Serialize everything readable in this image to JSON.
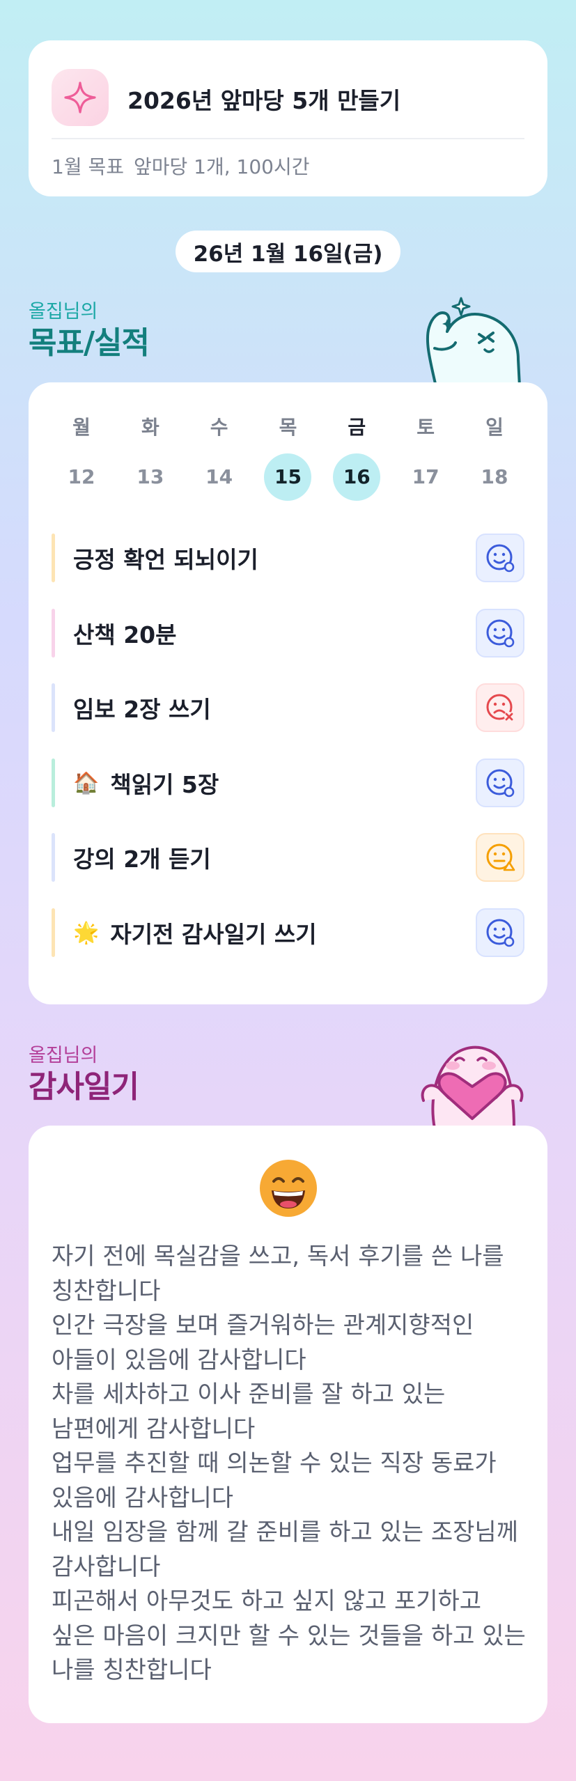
{
  "goal": {
    "title": "2026년 앞마당 5개 만들기",
    "month_label": "1월 목표",
    "month_value": "앞마당 1개, 100시간",
    "icon": "sparkle-icon"
  },
  "date_label": "26년 1월 16일(금)",
  "goals_section": {
    "owner": "올집님의",
    "title": "목표/실적"
  },
  "week": {
    "days": [
      {
        "name": "월",
        "num": "12"
      },
      {
        "name": "화",
        "num": "13"
      },
      {
        "name": "수",
        "num": "14"
      },
      {
        "name": "목",
        "num": "15"
      },
      {
        "name": "금",
        "num": "16"
      },
      {
        "name": "토",
        "num": "17"
      },
      {
        "name": "일",
        "num": "18"
      }
    ],
    "today_index": 4,
    "highlighted_index": [
      3,
      4
    ]
  },
  "habits": [
    {
      "label": "긍정 확언 되뇌이기",
      "emoji": "",
      "status": "done",
      "bar_color": "#fde4b4"
    },
    {
      "label": "산책 20분",
      "emoji": "",
      "status": "done",
      "bar_color": "#f8d3ea"
    },
    {
      "label": "임보 2장 쓰기",
      "emoji": "",
      "status": "failed",
      "bar_color": "#dbe3fb"
    },
    {
      "label": "책읽기 5장",
      "emoji": "🏠",
      "status": "done",
      "bar_color": "#b9eedc"
    },
    {
      "label": "강의 2개 듣기",
      "emoji": "",
      "status": "partial",
      "bar_color": "#dbe3fb"
    },
    {
      "label": "자기전 감사일기 쓰기",
      "emoji": "🌟",
      "status": "done",
      "bar_color": "#fde4b4"
    }
  ],
  "gratitude_section": {
    "owner": "올집님의",
    "title": "감사일기"
  },
  "gratitude": {
    "mood_icon": "grinning-face-icon",
    "entries": [
      "자기 전에 목실감을 쓰고, 독서 후기를 쓴 나를 칭찬합니다",
      "인간 극장을 보며 즐거워하는 관계지향적인 아들이 있음에 감사합니다",
      "차를 세차하고 이사 준비를 잘 하고 있는 남편에게 감사합니다",
      "업무를 추진할 때 의논할 수 있는 직장 동료가 있음에 감사합니다",
      "내일 임장을 함께 갈 준비를 하고 있는 조장님께 감사합니다",
      "피곤해서 아무것도 하고 싶지 않고 포기하고 싶은 마음이 크지만 할 수 있는 것들을 하고 있는 나를 칭찬합니다"
    ]
  },
  "colors": {
    "done": "#3b5bdb",
    "failed": "#e5484d",
    "partial": "#f59f00",
    "teal_title": "#137f7d",
    "purple_title": "#8e2478"
  }
}
